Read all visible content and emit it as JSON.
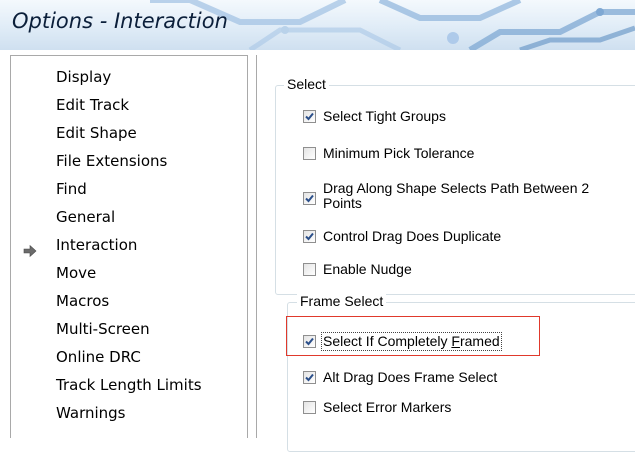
{
  "window": {
    "title": "Options - Interaction"
  },
  "sidebar": {
    "items": [
      {
        "label": "Display",
        "selected": false
      },
      {
        "label": "Edit Track",
        "selected": false
      },
      {
        "label": "Edit Shape",
        "selected": false
      },
      {
        "label": "File Extensions",
        "selected": false
      },
      {
        "label": "Find",
        "selected": false
      },
      {
        "label": "General",
        "selected": false
      },
      {
        "label": "Interaction",
        "selected": true
      },
      {
        "label": "Move",
        "selected": false
      },
      {
        "label": "Macros",
        "selected": false
      },
      {
        "label": "Multi-Screen",
        "selected": false
      },
      {
        "label": "Online DRC",
        "selected": false
      },
      {
        "label": "Track Length Limits",
        "selected": false
      },
      {
        "label": "Warnings",
        "selected": false
      }
    ]
  },
  "select_group": {
    "label": "Select",
    "options": [
      {
        "label": "Select Tight Groups",
        "checked": true
      },
      {
        "label": "Minimum Pick Tolerance",
        "checked": false
      },
      {
        "label": "Drag Along Shape Selects Path Between 2 Points",
        "checked": true
      },
      {
        "label": "Control Drag Does Duplicate",
        "checked": true
      },
      {
        "label": "Enable Nudge",
        "checked": false
      }
    ]
  },
  "frame_select_group": {
    "label": "Frame Select",
    "options": [
      {
        "label_pre": "Select If Completely ",
        "label_u": "F",
        "label_post": "ramed",
        "checked": true
      },
      {
        "label": "Alt Drag Does Frame Select",
        "checked": true
      },
      {
        "label": "Select Error Markers",
        "checked": false
      }
    ]
  },
  "colors": {
    "title_text": "#0b1f3a",
    "highlight_border": "#e0392c",
    "checkmark": "#2b4f8a"
  }
}
